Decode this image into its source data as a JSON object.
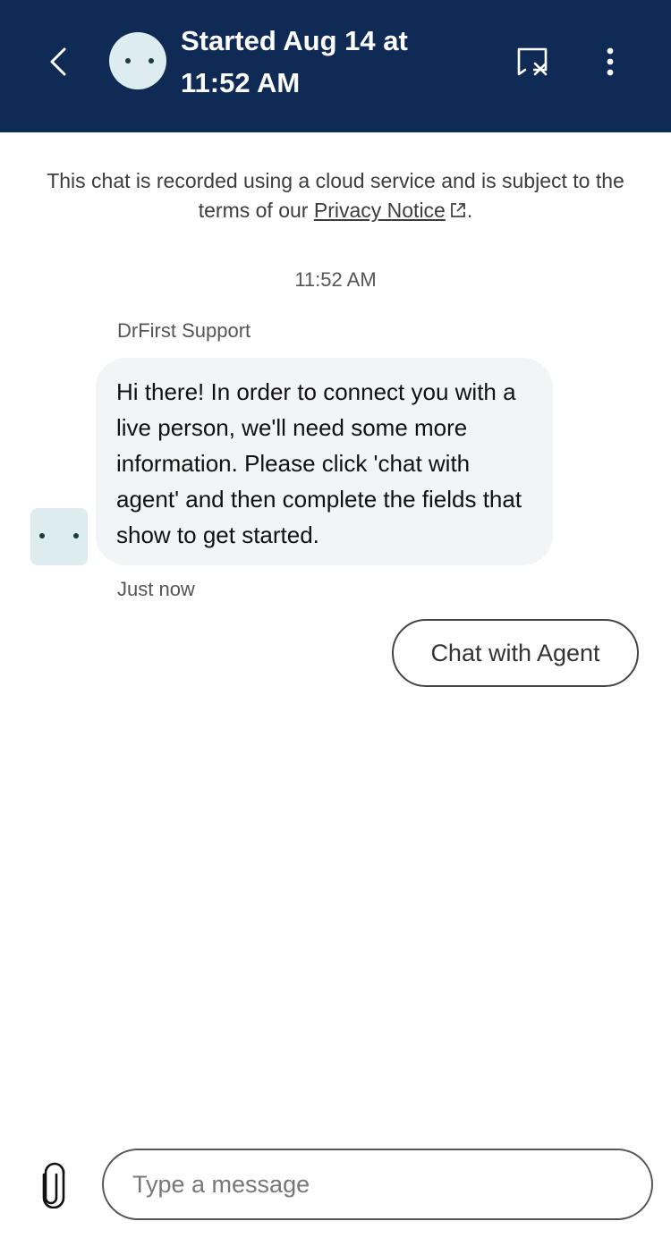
{
  "header": {
    "title": "Started Aug 14 at 11:52 AM",
    "back_icon": "chevron-left-icon",
    "end_chat_icon": "chat-close-icon",
    "menu_icon": "more-vertical-icon",
    "background_color": "#0f2a55"
  },
  "privacy": {
    "text_before": "This chat is recorded using a cloud service and is subject to the terms of our ",
    "link_label": "Privacy Notice",
    "text_after": "."
  },
  "conversation": {
    "timestamp": "11:52 AM",
    "messages": [
      {
        "sender": "DrFirst Support",
        "text": "Hi there! In order to connect you with a live person, we'll need some more information. Please click 'chat with agent' and then complete the fields that show to get started.",
        "meta": "Just now"
      }
    ],
    "quick_reply": "Chat with Agent"
  },
  "composer": {
    "placeholder": "Type a message",
    "attach_icon": "paperclip-icon"
  }
}
